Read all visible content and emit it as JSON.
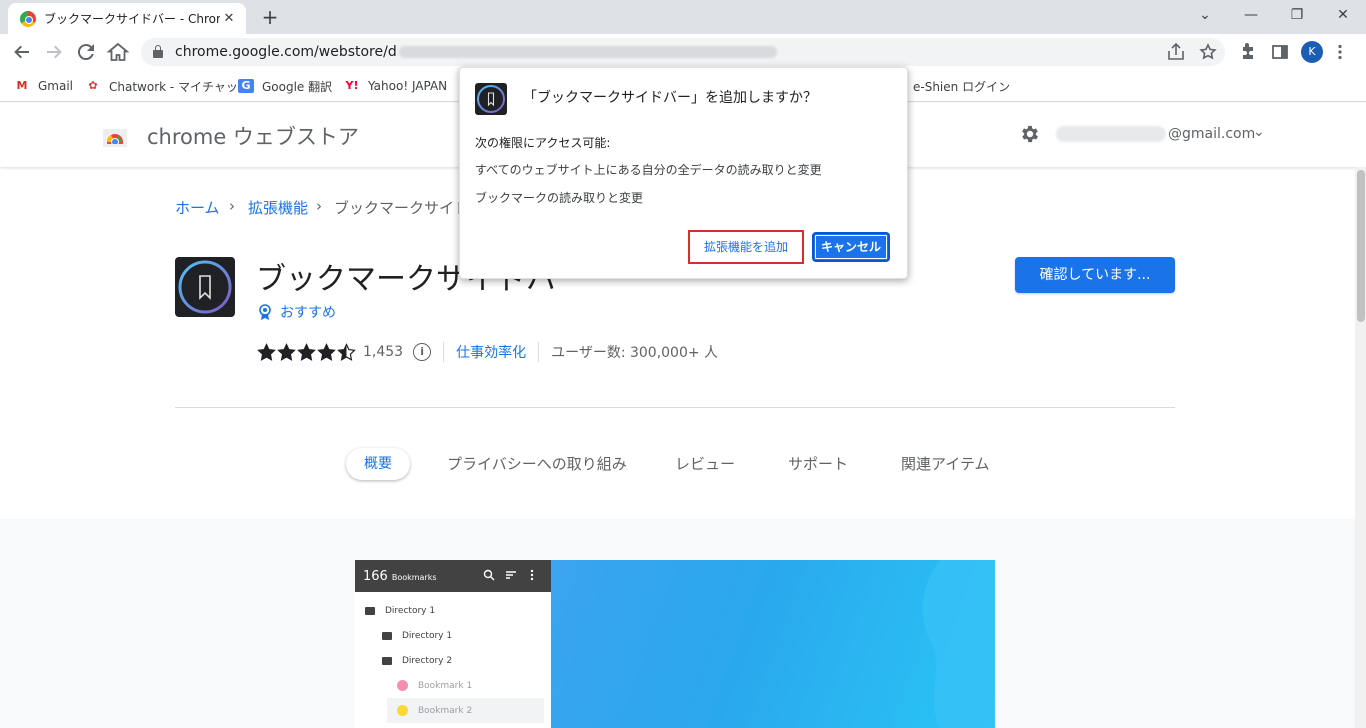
{
  "browser": {
    "tab_title": "ブックマークサイドバー - Chrome ウェブストア",
    "tab_close": "✕",
    "new_tab": "+",
    "url_visible": "chrome.google.com/webstore/d",
    "avatar_letter": "K",
    "win_min": "⌄",
    "win_minimize": "—",
    "win_restore": "❐",
    "win_close": "✕"
  },
  "bookmarks": [
    {
      "label": "Gmail",
      "icon": "M",
      "color": "#d93025"
    },
    {
      "label": "Chatwork - マイチャット",
      "icon": "✿",
      "color": "#e53935"
    },
    {
      "label": "Google 翻訳",
      "icon": "G",
      "color": "#4285f4"
    },
    {
      "label": "Yahoo! JAPAN",
      "icon": "Y!",
      "color": "#ff0033"
    },
    {
      "label": "e-Shien ログイン",
      "icon": "",
      "color": "#5f6368"
    }
  ],
  "store": {
    "name": "chrome ウェブストア",
    "account": "@gmail.com",
    "chevron": "⌄"
  },
  "breadcrumb": {
    "home": "ホーム",
    "sep": "›",
    "extensions": "拡張機能",
    "current": "ブックマークサイド"
  },
  "extension": {
    "title": "ブックマークサイドバー",
    "featured": "おすすめ",
    "rating": 4.5,
    "rating_count": "1,453",
    "info": "i",
    "category": "仕事効率化",
    "users": "ユーザー数: 300,000+ 人",
    "verify_button": "確認しています..."
  },
  "tabs": {
    "overview": "概要",
    "privacy": "プライバシーへの取り組み",
    "reviews": "レビュー",
    "support": "サポート",
    "related": "関連アイテム"
  },
  "screenshot": {
    "count": "166",
    "label": "Bookmarks",
    "rows": [
      {
        "label": "Directory 1",
        "type": "folder"
      },
      {
        "label": "Directory 1",
        "type": "folder"
      },
      {
        "label": "Directory 2",
        "type": "folder"
      },
      {
        "label": "Bookmark 1",
        "type": "bookmark",
        "color": "#f48fb1"
      },
      {
        "label": "Bookmark 2",
        "type": "bookmark",
        "color": "#fdd835"
      }
    ]
  },
  "dialog": {
    "title": "「ブックマークサイドバー」を追加しますか？",
    "subtitle": "次の権限にアクセス可能:",
    "permissions": [
      "すべてのウェブサイト上にある自分の全データの読み取りと変更",
      "ブックマークの読み取りと変更"
    ],
    "add_button": "拡張機能を追加",
    "cancel_button": "キャンセル"
  },
  "colors": {
    "accent": "#1a73e8",
    "highlight_border": "#d32f2f"
  }
}
